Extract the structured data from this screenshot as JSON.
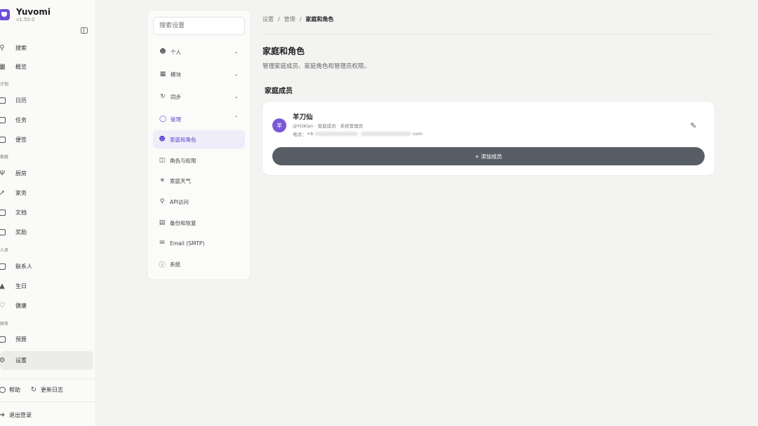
{
  "app": {
    "name": "Yuvomi",
    "version": "v1.50.0"
  },
  "sidebar": {
    "search": {
      "label": "搜索",
      "icon": "search-icon"
    },
    "overview": {
      "label": "概览",
      "icon": "grid-icon"
    },
    "sections": [
      {
        "label": "计划"
      },
      {
        "label": "家庭"
      },
      {
        "label": "人员"
      },
      {
        "label": "财务"
      }
    ],
    "items": [
      {
        "label": "日历",
        "icon": "calendar-icon"
      },
      {
        "label": "任务",
        "icon": "check-square-icon"
      },
      {
        "label": "便签",
        "icon": "note-icon"
      },
      {
        "label": "厨房",
        "icon": "utensils-icon"
      },
      {
        "label": "家务",
        "icon": "broom-icon"
      },
      {
        "label": "文档",
        "icon": "folder-icon"
      },
      {
        "label": "奖励",
        "icon": "gift-icon"
      },
      {
        "label": "联系人",
        "icon": "contact-card-icon"
      },
      {
        "label": "生日",
        "icon": "cake-icon"
      },
      {
        "label": "健康",
        "icon": "heart-icon"
      },
      {
        "label": "预算",
        "icon": "wallet-icon"
      },
      {
        "label": "设置",
        "icon": "gear-icon"
      }
    ],
    "footer": {
      "help": "帮助",
      "changelog": "更新日志",
      "logout": "退出登录"
    }
  },
  "settings_menu": {
    "search_placeholder": "搜索设置",
    "groups": [
      {
        "label": "个人",
        "icon": "user-icon",
        "expanded": false
      },
      {
        "label": "模块",
        "icon": "modules-icon",
        "expanded": false
      },
      {
        "label": "同步",
        "icon": "sync-icon",
        "expanded": false
      },
      {
        "label": "管理",
        "icon": "shield-icon",
        "expanded": true
      }
    ],
    "admin_items": [
      {
        "label": "家庭和角色",
        "icon": "users-icon",
        "active": true
      },
      {
        "label": "角色与权限",
        "icon": "database-icon",
        "active": false
      },
      {
        "label": "家庭天气",
        "icon": "weather-icon",
        "active": false
      },
      {
        "label": "API访问",
        "icon": "key-icon",
        "active": false
      },
      {
        "label": "备份和恢复",
        "icon": "archive-icon",
        "active": false
      },
      {
        "label": "Email (SMTP)",
        "icon": "mail-icon",
        "active": false
      },
      {
        "label": "系统",
        "icon": "info-icon",
        "active": false
      }
    ]
  },
  "breadcrumb": {
    "items": [
      "设置",
      "管理",
      "家庭和角色"
    ]
  },
  "page": {
    "title": "家庭和角色",
    "description": "管理家庭成员、家庭角色和管理员权限。",
    "section_title": "家庭成员"
  },
  "member": {
    "avatar_initial": "羊",
    "name": "羊刀仙",
    "meta": "@YOKian · 家庭成员 · 系统管理员",
    "phone_label": "电话",
    "phone_prefix": "+8",
    "email_suffix": "com"
  },
  "actions": {
    "add_member": "+ 添加成员"
  },
  "colors": {
    "accent": "#5b3fd0",
    "avatar": "#7a57d6",
    "add_button": "#585e65"
  }
}
